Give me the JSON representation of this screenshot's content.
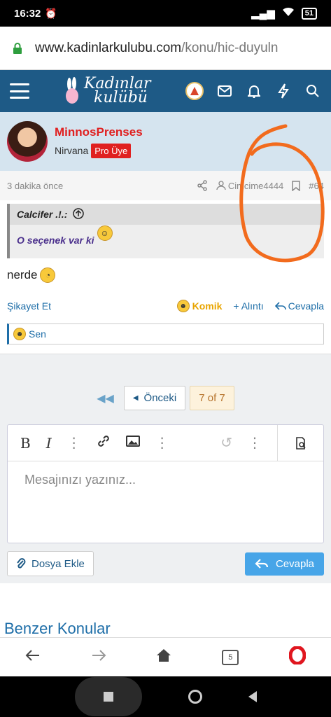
{
  "status": {
    "time": "16:32",
    "battery": "51"
  },
  "url": {
    "host": "www.kadinlarkulubu.com",
    "path": "/konu/hic-duyuln"
  },
  "site": {
    "logo_line1": "Kadınlar",
    "logo_line2": "kulübü"
  },
  "post": {
    "username": "MinnosPrenses",
    "rank": "Nirvana",
    "badge": "Pro Üye",
    "time": "3 dakika önce",
    "mention": "Cimcime4444",
    "post_number": "#64",
    "quote_author": "Calcifer .!.:",
    "quote_text": "O seçenek var ki",
    "message": "nerde",
    "report": "Şikayet Et",
    "reaction": "Komik",
    "quote_btn": "+ Alıntı",
    "reply_btn": "Cevapla",
    "reacted_by": "Sen"
  },
  "pager": {
    "prev": "Önceki",
    "current": "7 of 7"
  },
  "editor": {
    "placeholder": "Mesajınızı yazınız...",
    "attach": "Dosya Ekle",
    "submit": "Cevapla"
  },
  "similar": {
    "title": "Benzer Konular"
  },
  "browser": {
    "tabs": "5"
  },
  "colors": {
    "header": "#1e5a86",
    "userbar": "#d5e4ef",
    "link": "#1e6ea8",
    "username": "#e02020",
    "annotation": "#f26b1d"
  }
}
